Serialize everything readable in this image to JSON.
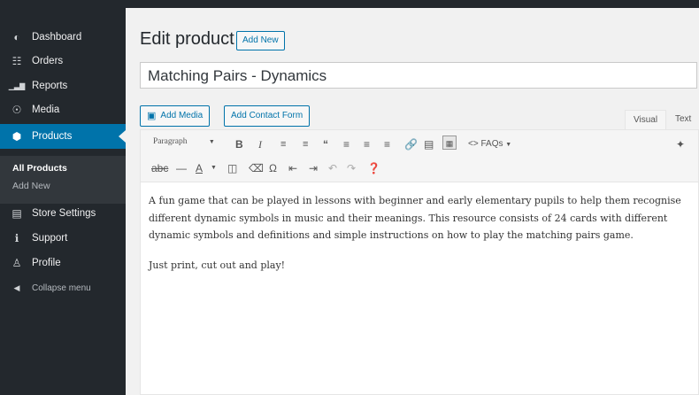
{
  "sidebar": {
    "items": [
      {
        "label": "Dashboard",
        "icon": "dashboard-icon",
        "glyph": "◐"
      },
      {
        "label": "Orders",
        "icon": "orders-icon",
        "glyph": "☷"
      },
      {
        "label": "Reports",
        "icon": "reports-icon",
        "glyph": "▁▃▇"
      },
      {
        "label": "Media",
        "icon": "media-icon",
        "glyph": "☉"
      },
      {
        "label": "Products",
        "icon": "products-icon",
        "glyph": "⬢"
      },
      {
        "label": "Store Settings",
        "icon": "store-settings-icon",
        "glyph": "▤"
      },
      {
        "label": "Support",
        "icon": "support-icon",
        "glyph": "ℹ"
      },
      {
        "label": "Profile",
        "icon": "profile-icon",
        "glyph": "♙"
      },
      {
        "label": "Collapse menu",
        "icon": "collapse-icon",
        "glyph": "◀"
      }
    ],
    "submenu": {
      "all_products": "All Products",
      "add_new": "Add New"
    }
  },
  "page": {
    "heading": "Edit product",
    "add_new": "Add New",
    "title_value": "Matching Pairs - Dynamics"
  },
  "editor": {
    "add_media": "Add Media",
    "add_contact_form": "Add Contact Form",
    "tab_visual": "Visual",
    "tab_text": "Text",
    "format": "Paragraph",
    "faqs": "FAQs",
    "paragraphs": [
      "A fun game that can be played in lessons with beginner and early elementary pupils to help them recognise different dynamic symbols in music and their meanings.  This resource consists of 24 cards with different dynamic symbols and definitions and simple instructions on how to play the matching pairs game.",
      "Just print, cut out and play!"
    ]
  },
  "colors": {
    "sidebar": "#23282d",
    "active": "#0073aa",
    "link": "#0073aa"
  }
}
